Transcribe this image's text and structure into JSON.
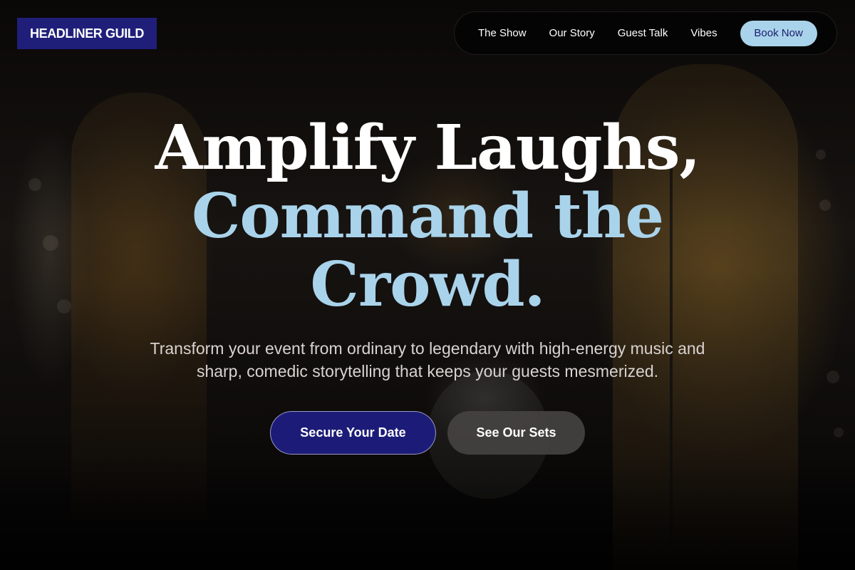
{
  "brand": {
    "name": "HEADLINER GUILD",
    "logo_bg": "#1f1f7a"
  },
  "nav": {
    "items": [
      {
        "label": "The Show"
      },
      {
        "label": "Our Story"
      },
      {
        "label": "Guest Talk"
      },
      {
        "label": "Vibes"
      }
    ],
    "cta_label": "Book Now",
    "cta_bg": "#a9d3ea"
  },
  "hero": {
    "headline_line1": "Amplify Laughs,",
    "headline_line2": "Command the",
    "headline_line3": "Crowd.",
    "accent_color": "#a9d3ea",
    "subtitle": "Transform your event from ordinary to legendary with high-energy music and sharp, comedic storytelling that keeps your guests mesmerized.",
    "primary_button": "Secure Your Date",
    "secondary_button": "See Our Sets",
    "background_image": "band-performing-on-stage-photo"
  }
}
